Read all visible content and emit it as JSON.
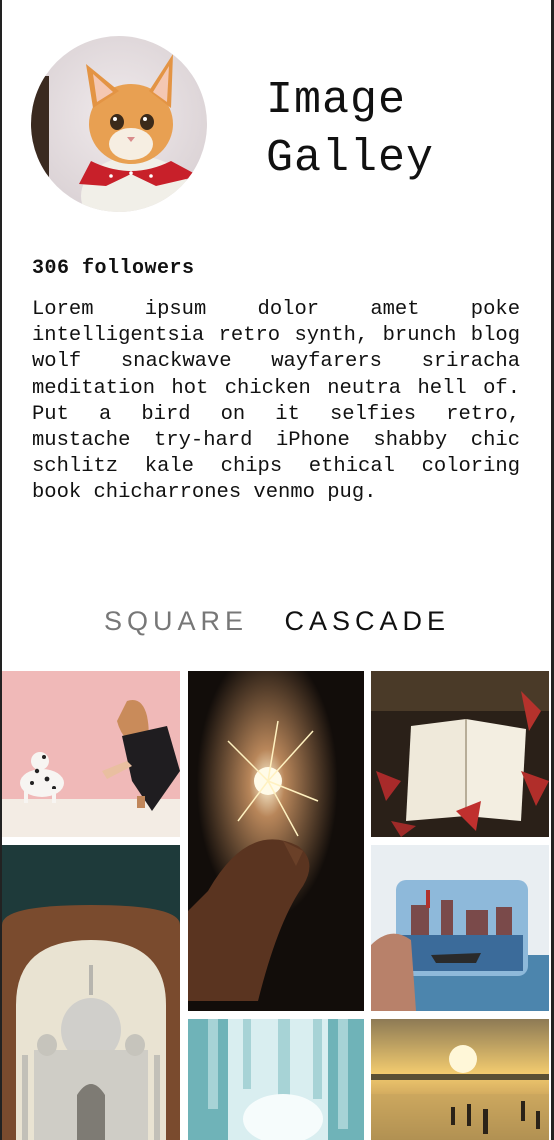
{
  "header": {
    "title_line1": "Image",
    "title_line2": "Galley",
    "followers": "306 followers",
    "bio": "Lorem ipsum dolor amet poke intelligentsia retro synth, brunch blog wolf snackwave wayfarers sriracha meditation hot chicken neutra hell of. Put a bird on it selfies retro, mustache try-hard iPhone shabby chic schlitz kale chips ethical coloring book chicharrones venmo pug."
  },
  "tabs": [
    {
      "label": "SQUARE",
      "active": false
    },
    {
      "label": "CASCADE",
      "active": true
    }
  ],
  "colors": {
    "accent": "#111111",
    "inactive_tab": "#777777",
    "frame": "#222222"
  },
  "gallery": {
    "items": [
      {
        "name": "woman-with-dalmatian-photo"
      },
      {
        "name": "sparkler-in-hand-photo"
      },
      {
        "name": "open-book-with-leaves-photo"
      },
      {
        "name": "taj-mahal-arch-photo"
      },
      {
        "name": "postcard-over-water-photo"
      },
      {
        "name": "frozen-waterfall-photo"
      },
      {
        "name": "beach-sunset-photo"
      }
    ]
  }
}
